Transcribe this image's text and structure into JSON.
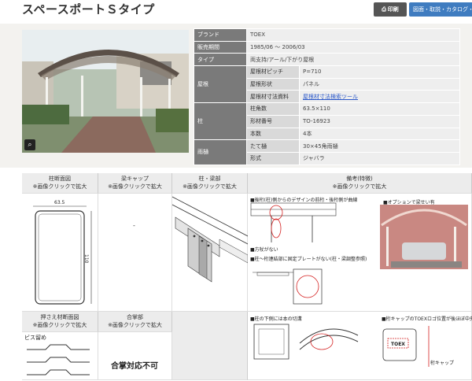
{
  "header": {
    "title": "スペースポートＳタイプ",
    "print_label": "印刷",
    "docs_label": "図面・取説・カタログ・"
  },
  "spec": {
    "brand_label": "ブランド",
    "brand": "TOEX",
    "period_label": "販売期間",
    "period": "1985/06 〜 2006/03",
    "type_label": "タイプ",
    "type": "両支持/アール/下がり屋根",
    "roof_label": "屋根",
    "roof_pitch_label": "屋根材ピッチ",
    "roof_pitch": "P=710",
    "roof_shape_label": "屋根形状",
    "roof_shape": "パネル",
    "roof_size_label": "屋根材寸法資料",
    "roof_size": "屋根材寸法検索ツール",
    "pillar_label": "柱",
    "pillar_dim_label": "柱角数",
    "pillar_dim": "63.5×110",
    "pillar_part_label": "形材番号",
    "pillar_part": "TO-16923",
    "pillar_count_label": "本数",
    "pillar_count": "4本",
    "gutter_label": "雨樋",
    "gutter_vert_label": "たて樋",
    "gutter_vert": "30×45角雨樋",
    "gutter_form_label": "形式",
    "gutter_form": "ジャバラ"
  },
  "grid": {
    "col1_title": "柱断面図",
    "col1_note": "※画像クリックで拡大",
    "col2_title": "梁キャップ",
    "col2_note": "※画像クリックで拡大",
    "col3_title": "柱・梁部",
    "col3_note": "※画像クリックで拡大",
    "col4_title": "備考(特徴)",
    "col4_note": "※画像クリックで拡大",
    "col2_value": "-",
    "dim_w": "63.5",
    "dim_h": "110",
    "row2_col1_title": "押さえ材断面図",
    "row2_col1_note": "※画像クリックで拡大",
    "row2_col2_title": "合掌部",
    "row2_col2_note": "※画像クリックで拡大",
    "screw_label": "ビス留め",
    "gassho_text": "合掌対応不可",
    "note1": "■後桁(柱)側からのデザインの前桁・後桁側が曲線",
    "note2": "■オプションで梁せい有",
    "note3": "■方杖がない",
    "note4": "■柱〜桁連結部に固定プレートがない(柱・梁調整参照)",
    "note5": "■柱の下側には本の切溝",
    "note6": "■桁キャップのTOEXロゴ位置が後ほぼ中央",
    "beam_cap_label": "桁キャップ",
    "logo_text": "TOEX"
  }
}
